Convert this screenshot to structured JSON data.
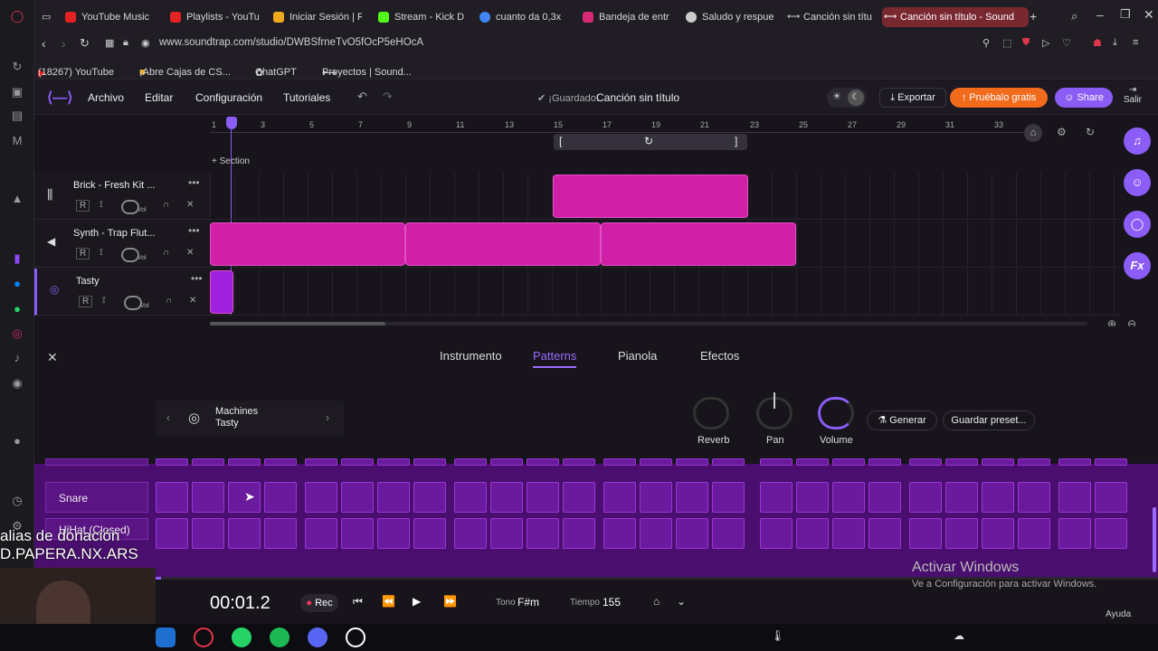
{
  "tabs": [
    {
      "label": "YouTube Music",
      "color": "#e52222"
    },
    {
      "label": "Playlists - YouTu",
      "color": "#e52222"
    },
    {
      "label": "Iniciar Sesión | R",
      "color": "#f2a81d"
    },
    {
      "label": "Stream - Kick D",
      "color": "#53fc18"
    },
    {
      "label": "cuanto da 0,3x",
      "color": "#4285f4"
    },
    {
      "label": "Bandeja de entr",
      "color": "#d62976"
    },
    {
      "label": "Saludo y respue",
      "color": "#cccccc"
    },
    {
      "label": "Canción sin títu",
      "color": "#8b8bff"
    },
    {
      "label": "Canción sin título - Sound",
      "color": "#8b8bff"
    }
  ],
  "address": {
    "url": "www.soundtrap.com/studio/DWBSfrneTvO5fOcP5eHOcA"
  },
  "bookmarks": [
    "(18267) YouTube",
    "¡Abre Cajas de CS...",
    "ChatGPT",
    "Proyectos | Sound..."
  ],
  "header": {
    "menus": [
      "Archivo",
      "Editar",
      "Configuración",
      "Tutoriales"
    ],
    "saved": "¡Guardado!",
    "title": "Canción sin título",
    "export": "Exportar",
    "try": "Pruébalo gratis",
    "share": "Share",
    "exit": "Salir"
  },
  "ruler": {
    "ticks": [
      "1",
      "3",
      "5",
      "7",
      "9",
      "11",
      "13",
      "15",
      "17",
      "19",
      "21",
      "23",
      "25",
      "27",
      "29",
      "31",
      "33"
    ],
    "section": "Section"
  },
  "tracks": [
    {
      "name": "Brick - Fresh Kit ...",
      "r": "R",
      "vol": "Vol"
    },
    {
      "name": "Synth - Trap Flut...",
      "r": "R",
      "vol": "Vol"
    },
    {
      "name": "Tasty",
      "r": "R",
      "vol": "Vol"
    }
  ],
  "panel": {
    "tabs": [
      "Instrumento",
      "Patterns",
      "Pianola",
      "Efectos"
    ],
    "instrument_type": "Machines",
    "instrument_name": "Tasty",
    "knobs": [
      "Reverb",
      "Pan",
      "Volume"
    ],
    "generate": "Generar",
    "save_preset": "Guardar preset..."
  },
  "grid": {
    "rows": [
      "Snare",
      "HiHat (Closed)"
    ]
  },
  "transport": {
    "time": "00:01.2",
    "rec": "Rec",
    "key_label": "Tono",
    "key": "F#m",
    "tempo_label": "Tiempo",
    "tempo": "155"
  },
  "overlay": {
    "line1": "alias de donación",
    "line2": "D.PAPERA.NX.ARS"
  },
  "windows": {
    "title": "Activar Windows",
    "sub": "Ve a Configuración para activar Windows.",
    "help": "Ayuda"
  },
  "colors": {
    "accent": "#8b5cf6",
    "clip": "#d020a8",
    "orange": "#f26b1d"
  }
}
